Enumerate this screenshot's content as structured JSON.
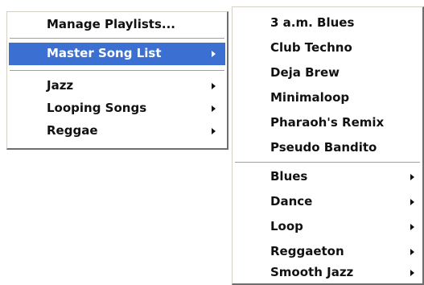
{
  "main_menu": {
    "items": [
      {
        "label": "Manage Playlists..."
      },
      {
        "label": "Master Song List",
        "selected": true
      },
      {
        "label": "Jazz"
      },
      {
        "label": "Looping Songs"
      },
      {
        "label": "Reggae"
      }
    ]
  },
  "submenu": {
    "songs": [
      {
        "label": "3 a.m. Blues"
      },
      {
        "label": "Club Techno"
      },
      {
        "label": "Deja Brew"
      },
      {
        "label": "Minimaloop"
      },
      {
        "label": "Pharaoh's Remix"
      },
      {
        "label": "Pseudo Bandito"
      }
    ],
    "categories": [
      {
        "label": "Blues"
      },
      {
        "label": "Dance"
      },
      {
        "label": "Loop"
      },
      {
        "label": "Reggaeton"
      },
      {
        "label": "Smooth Jazz"
      }
    ]
  },
  "colors": {
    "selection": "#3c6fd2",
    "selection_text": "#ffffff",
    "text": "#111111"
  }
}
